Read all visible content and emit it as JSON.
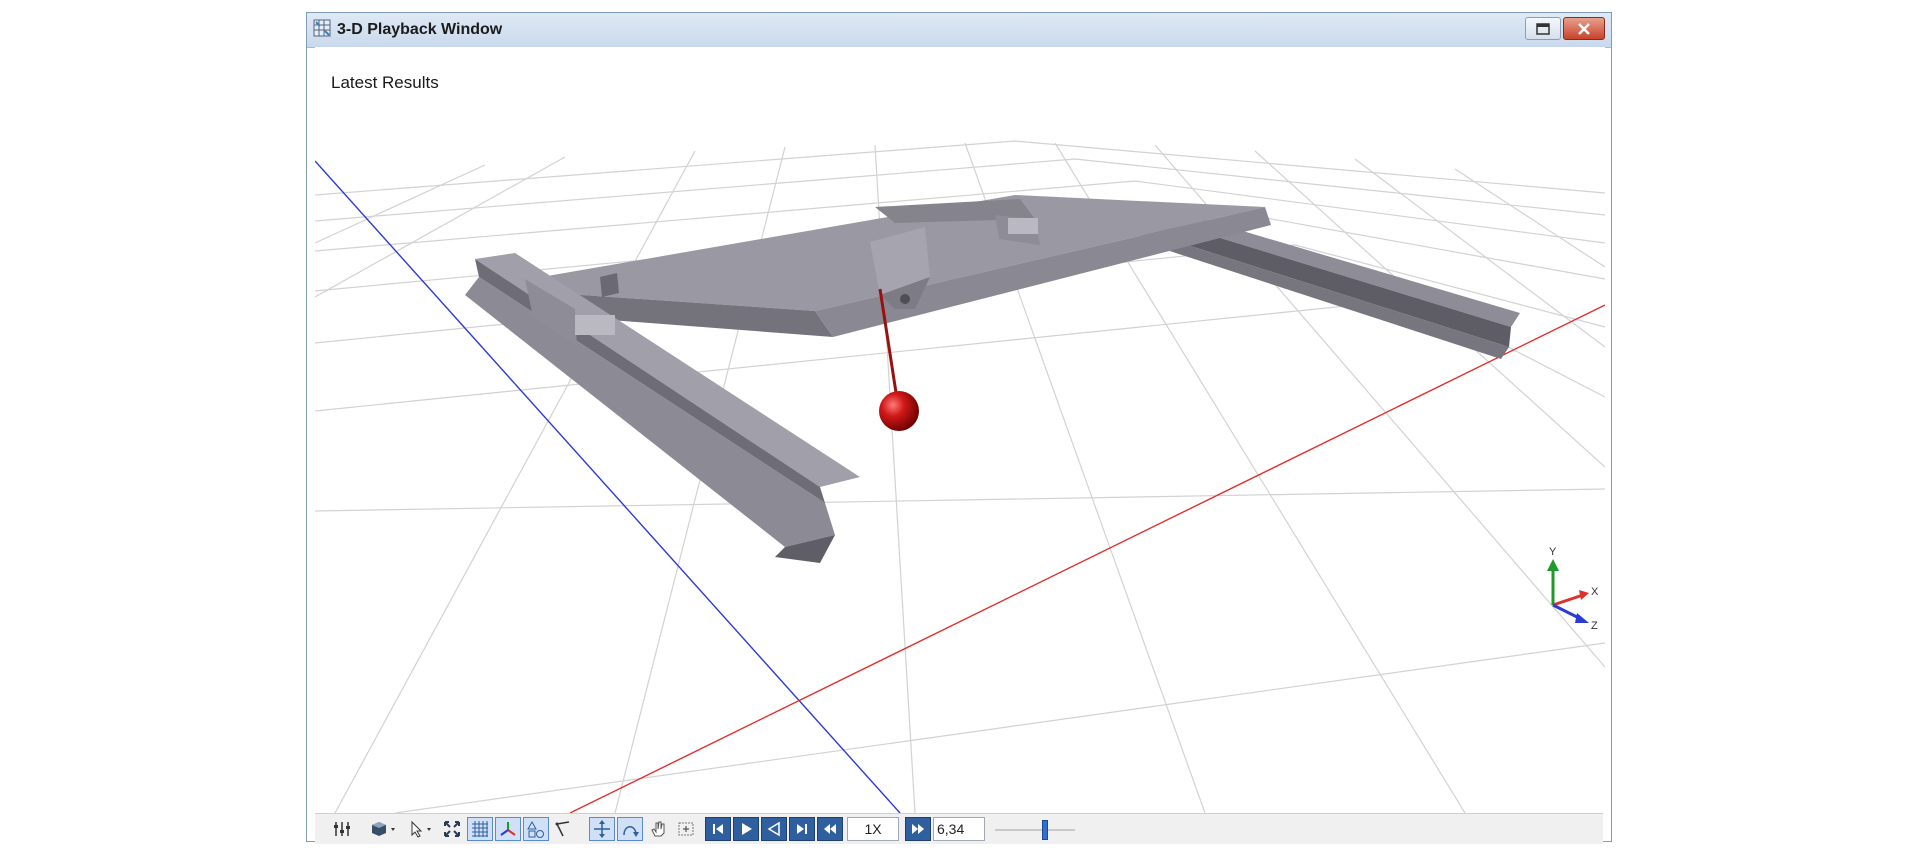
{
  "window": {
    "title": "3-D Playback Window"
  },
  "viewport": {
    "overlay_label": "Latest Results",
    "axis_labels": {
      "y": "Y",
      "x": "X",
      "z": "Z"
    }
  },
  "toolbar": {
    "speed": "1X",
    "time": "6,34",
    "slider_fraction": 0.62
  },
  "colors": {
    "x_axis": "#e0302a",
    "z_axis": "#2b3bd6",
    "y_axis": "#1e9a2a",
    "beam": "#9a98a3",
    "beam_dark": "#66646d",
    "ball": "#d01818",
    "grid": "#cfcfcf"
  },
  "icons": [
    "window-app-icon",
    "maximize-icon",
    "close-icon",
    "settings-icon",
    "cube-view-icon",
    "select-arrow-icon",
    "fit-view-icon",
    "grid-toggle-icon",
    "axes-toggle-icon",
    "shapes-icon",
    "measure-icon",
    "pan-icon",
    "rotate-icon",
    "hand-icon",
    "zoom-box-icon",
    "skip-start-icon",
    "play-icon",
    "step-back-icon",
    "skip-end-icon",
    "rewind-icon",
    "fast-forward-icon"
  ]
}
